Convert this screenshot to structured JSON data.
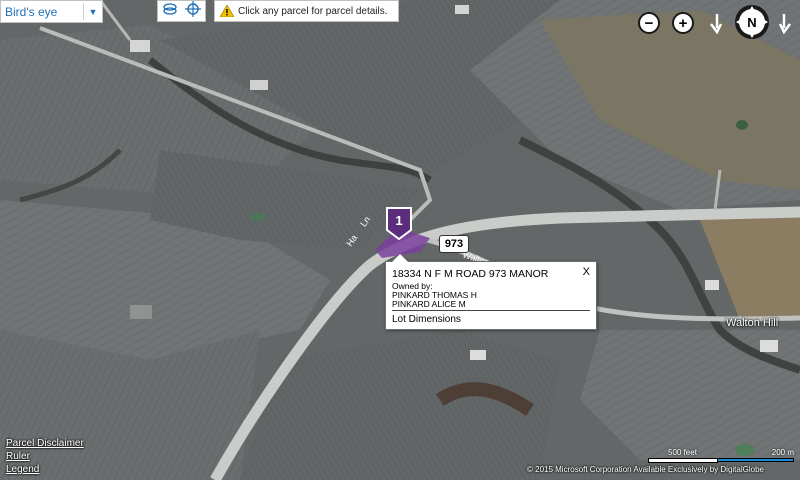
{
  "map_style": {
    "label": "Bird's eye"
  },
  "notice": {
    "text": "Click any parcel for parcel details."
  },
  "nav": {
    "zoom_out": "−",
    "zoom_in": "+",
    "compass": "N"
  },
  "marker": {
    "number": "1",
    "color": "#5b2d7c"
  },
  "road_shield": {
    "text": "973"
  },
  "road_labels": {
    "walton": "Walton",
    "lane": "Ha     Ln"
  },
  "place_label": "Walton Hill",
  "popup": {
    "address": "18334 N F M ROAD 973 MANOR",
    "close": "X",
    "owned_by": "Owned by:",
    "owners": [
      "PINKARD THOMAS H",
      "PINKARD ALICE M"
    ],
    "lot_dimensions": "Lot Dimensions"
  },
  "links": {
    "disclaimer": "Parcel Disclaimer",
    "ruler": "Ruler",
    "legend": "Legend"
  },
  "scale": {
    "feet": "500 feet",
    "meters": "200 m"
  },
  "copyright": "© 2015 Microsoft Corporation    Available Exclusively by DigitalGlobe",
  "colors": {
    "accent_blue": "#1d6fb8",
    "parcel_purple": "#7a3f9e",
    "warning_yellow": "#f2c200"
  }
}
